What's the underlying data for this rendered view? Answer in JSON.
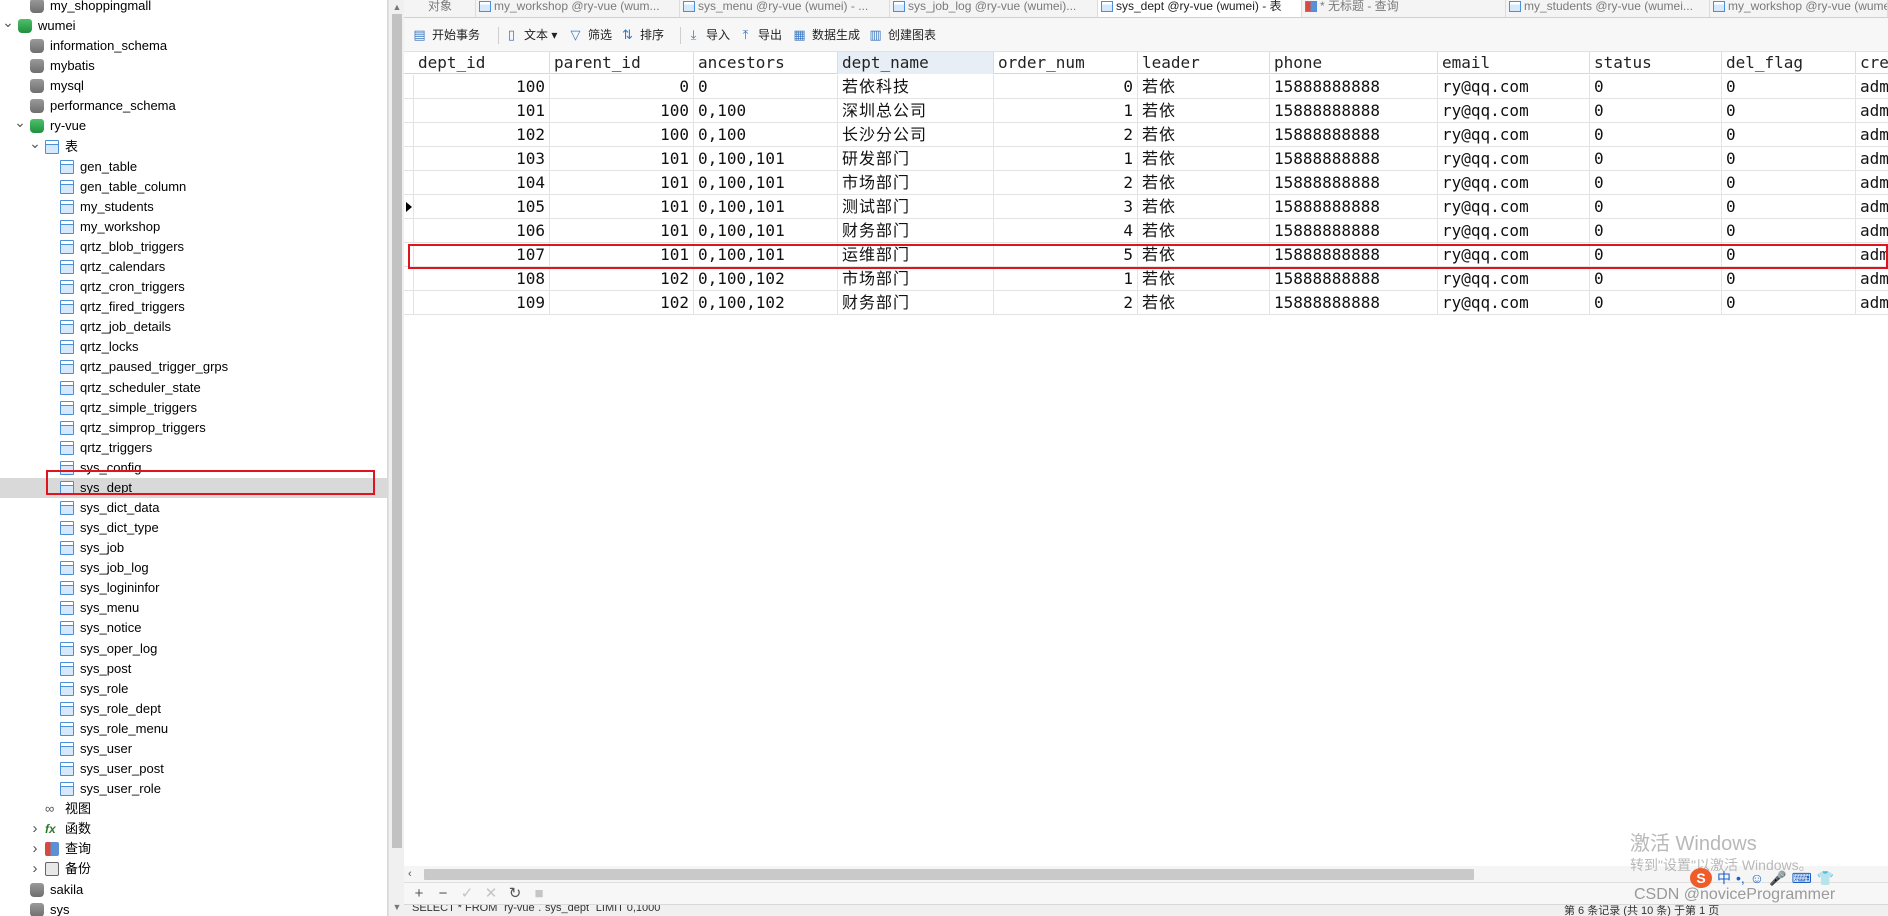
{
  "navigator": {
    "items": [
      {
        "label": "my_shoppingmall",
        "type": "db",
        "level": 1,
        "arrow": ""
      },
      {
        "label": "wumei",
        "type": "conn",
        "level": 0,
        "arrow": "v"
      },
      {
        "label": "information_schema",
        "type": "db",
        "level": 1,
        "arrow": ""
      },
      {
        "label": "mybatis",
        "type": "db",
        "level": 1,
        "arrow": ""
      },
      {
        "label": "mysql",
        "type": "db",
        "level": 1,
        "arrow": ""
      },
      {
        "label": "performance_schema",
        "type": "db",
        "level": 1,
        "arrow": ""
      },
      {
        "label": "ry-vue",
        "type": "db-open",
        "level": 1,
        "arrow": "v"
      },
      {
        "label": "表",
        "type": "table-group",
        "level": 2,
        "arrow": "v"
      },
      {
        "label": "gen_table",
        "type": "table",
        "level": 3,
        "arrow": ""
      },
      {
        "label": "gen_table_column",
        "type": "table",
        "level": 3,
        "arrow": ""
      },
      {
        "label": "my_students",
        "type": "table",
        "level": 3,
        "arrow": ""
      },
      {
        "label": "my_workshop",
        "type": "table",
        "level": 3,
        "arrow": ""
      },
      {
        "label": "qrtz_blob_triggers",
        "type": "table",
        "level": 3,
        "arrow": ""
      },
      {
        "label": "qrtz_calendars",
        "type": "table",
        "level": 3,
        "arrow": ""
      },
      {
        "label": "qrtz_cron_triggers",
        "type": "table",
        "level": 3,
        "arrow": ""
      },
      {
        "label": "qrtz_fired_triggers",
        "type": "table",
        "level": 3,
        "arrow": ""
      },
      {
        "label": "qrtz_job_details",
        "type": "table",
        "level": 3,
        "arrow": ""
      },
      {
        "label": "qrtz_locks",
        "type": "table",
        "level": 3,
        "arrow": ""
      },
      {
        "label": "qrtz_paused_trigger_grps",
        "type": "table",
        "level": 3,
        "arrow": ""
      },
      {
        "label": "qrtz_scheduler_state",
        "type": "table",
        "level": 3,
        "arrow": ""
      },
      {
        "label": "qrtz_simple_triggers",
        "type": "table",
        "level": 3,
        "arrow": ""
      },
      {
        "label": "qrtz_simprop_triggers",
        "type": "table",
        "level": 3,
        "arrow": ""
      },
      {
        "label": "qrtz_triggers",
        "type": "table",
        "level": 3,
        "arrow": ""
      },
      {
        "label": "sys_config",
        "type": "table",
        "level": 3,
        "arrow": ""
      },
      {
        "label": "sys_dept",
        "type": "table",
        "level": 3,
        "arrow": "",
        "selected": true
      },
      {
        "label": "sys_dict_data",
        "type": "table",
        "level": 3,
        "arrow": ""
      },
      {
        "label": "sys_dict_type",
        "type": "table",
        "level": 3,
        "arrow": ""
      },
      {
        "label": "sys_job",
        "type": "table",
        "level": 3,
        "arrow": ""
      },
      {
        "label": "sys_job_log",
        "type": "table",
        "level": 3,
        "arrow": ""
      },
      {
        "label": "sys_logininfor",
        "type": "table",
        "level": 3,
        "arrow": ""
      },
      {
        "label": "sys_menu",
        "type": "table",
        "level": 3,
        "arrow": ""
      },
      {
        "label": "sys_notice",
        "type": "table",
        "level": 3,
        "arrow": ""
      },
      {
        "label": "sys_oper_log",
        "type": "table",
        "level": 3,
        "arrow": ""
      },
      {
        "label": "sys_post",
        "type": "table",
        "level": 3,
        "arrow": ""
      },
      {
        "label": "sys_role",
        "type": "table",
        "level": 3,
        "arrow": ""
      },
      {
        "label": "sys_role_dept",
        "type": "table",
        "level": 3,
        "arrow": ""
      },
      {
        "label": "sys_role_menu",
        "type": "table",
        "level": 3,
        "arrow": ""
      },
      {
        "label": "sys_user",
        "type": "table",
        "level": 3,
        "arrow": ""
      },
      {
        "label": "sys_user_post",
        "type": "table",
        "level": 3,
        "arrow": ""
      },
      {
        "label": "sys_user_role",
        "type": "table",
        "level": 3,
        "arrow": ""
      },
      {
        "label": "视图",
        "type": "view-group",
        "level": 2,
        "arrow": ""
      },
      {
        "label": "函数",
        "type": "func-group",
        "level": 2,
        "arrow": ">"
      },
      {
        "label": "查询",
        "type": "query-group",
        "level": 2,
        "arrow": ">"
      },
      {
        "label": "备份",
        "type": "backup-group",
        "level": 2,
        "arrow": ">"
      },
      {
        "label": "sakila",
        "type": "db",
        "level": 1,
        "arrow": ""
      },
      {
        "label": "sys",
        "type": "db",
        "level": 1,
        "arrow": ""
      }
    ]
  },
  "tabs": [
    {
      "label": "对象",
      "kind": "objects"
    },
    {
      "label": "my_workshop @ry-vue (wum...",
      "kind": "table"
    },
    {
      "label": "sys_menu @ry-vue (wumei) - ...",
      "kind": "table"
    },
    {
      "label": "sys_job_log @ry-vue (wumei)...",
      "kind": "table"
    },
    {
      "label": "sys_dept @ry-vue (wumei) - 表",
      "kind": "table",
      "active": true
    },
    {
      "label": "* 无标题 - 查询",
      "kind": "query"
    },
    {
      "label": "my_students @ry-vue (wumei...",
      "kind": "table"
    },
    {
      "label": "my_workshop @ry-vue (wume...",
      "kind": "table"
    }
  ],
  "toolbar": {
    "begin_transaction": "开始事务",
    "text": "文本",
    "filter": "筛选",
    "sort": "排序",
    "import": "导入",
    "export": "导出",
    "generate_data": "数据生成",
    "create_chart": "创建图表"
  },
  "grid": {
    "columns": [
      "dept_id",
      "parent_id",
      "ancestors",
      "dept_name",
      "order_num",
      "leader",
      "phone",
      "email",
      "status",
      "del_flag",
      "cre"
    ],
    "rows": [
      [
        "100",
        "0",
        "0",
        "若依科技",
        "0",
        "若依",
        "15888888888",
        "ry@qq.com",
        "0",
        "0",
        "adm"
      ],
      [
        "101",
        "100",
        "0,100",
        "深圳总公司",
        "1",
        "若依",
        "15888888888",
        "ry@qq.com",
        "0",
        "0",
        "adm"
      ],
      [
        "102",
        "100",
        "0,100",
        "长沙分公司",
        "2",
        "若依",
        "15888888888",
        "ry@qq.com",
        "0",
        "0",
        "adm"
      ],
      [
        "103",
        "101",
        "0,100,101",
        "研发部门",
        "1",
        "若依",
        "15888888888",
        "ry@qq.com",
        "0",
        "0",
        "adm"
      ],
      [
        "104",
        "101",
        "0,100,101",
        "市场部门",
        "2",
        "若依",
        "15888888888",
        "ry@qq.com",
        "0",
        "0",
        "adm"
      ],
      [
        "105",
        "101",
        "0,100,101",
        "测试部门",
        "3",
        "若依",
        "15888888888",
        "ry@qq.com",
        "0",
        "0",
        "adm"
      ],
      [
        "106",
        "101",
        "0,100,101",
        "财务部门",
        "4",
        "若依",
        "15888888888",
        "ry@qq.com",
        "0",
        "0",
        "adm"
      ],
      [
        "107",
        "101",
        "0,100,101",
        "运维部门",
        "5",
        "若依",
        "15888888888",
        "ry@qq.com",
        "0",
        "0",
        "adm"
      ],
      [
        "108",
        "102",
        "0,100,102",
        "市场部门",
        "1",
        "若依",
        "15888888888",
        "ry@qq.com",
        "0",
        "0",
        "adm"
      ],
      [
        "109",
        "102",
        "0,100,102",
        "财务部门",
        "2",
        "若依",
        "15888888888",
        "ry@qq.com",
        "0",
        "0",
        "adm"
      ]
    ],
    "numeric_columns": [
      0,
      1,
      4
    ],
    "cjk_columns": [
      3,
      5
    ],
    "current_row": 5
  },
  "navbar": {
    "add": "+",
    "remove": "−",
    "apply": "✓",
    "discard": "✕",
    "refresh": "↻",
    "stop": "■"
  },
  "status": {
    "left": "SELECT * FROM `ry-vue`.`sys_dept` LIMIT 0,1000",
    "right": "第 6 条记录 (共 10 条) 于第 1 页"
  },
  "overlays": {
    "watermark_line1": "激活 Windows",
    "watermark_line2": "转到\"设置\"以激活 Windows。",
    "csdn": "CSDN @noviceProgrammer",
    "ime_logo": "S",
    "ime_items": [
      "中",
      "•,",
      "☺",
      "🎤",
      "⌨",
      "👕"
    ]
  },
  "colors": {
    "highlight_red": "#e0141e",
    "selected_bg": "#d9d9d9",
    "header_sorted": "#e8eef6"
  }
}
